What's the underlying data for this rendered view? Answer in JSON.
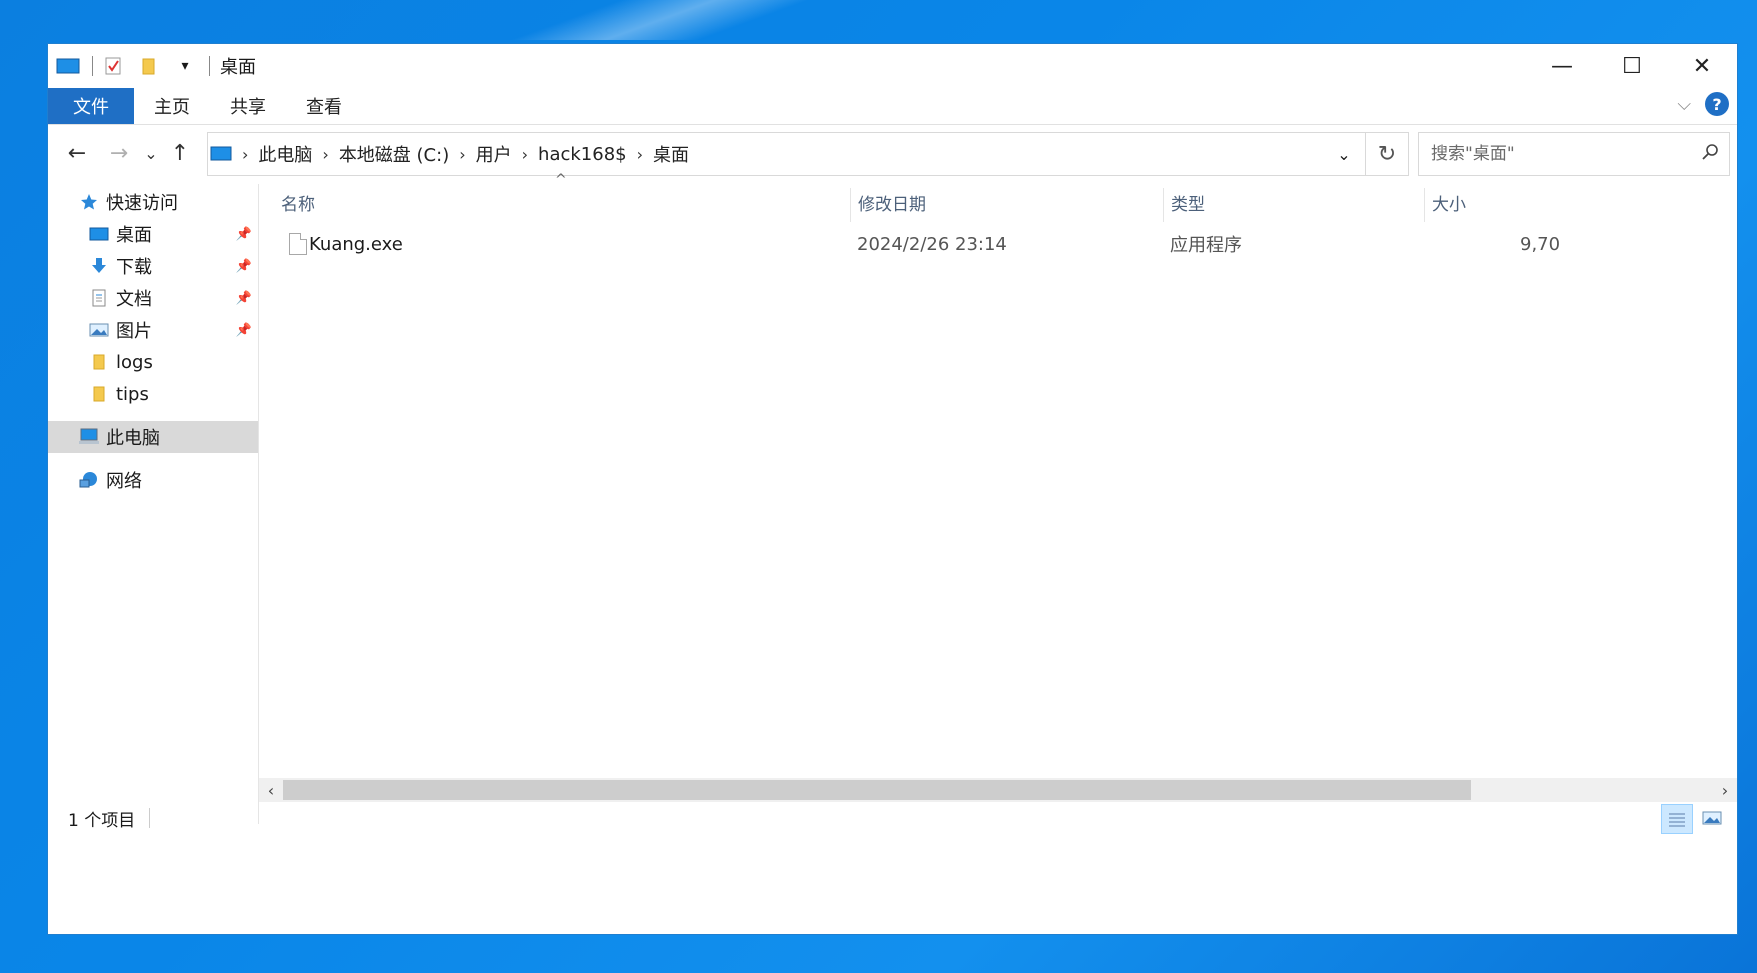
{
  "window": {
    "title": "桌面",
    "controls": {
      "minimize": "—",
      "maximize": "☐",
      "close": "✕"
    }
  },
  "ribbon": {
    "tabs": [
      "文件",
      "主页",
      "共享",
      "查看"
    ]
  },
  "nav": {
    "back": "←",
    "forward": "→",
    "recent": "⌄",
    "up": "↑",
    "breadcrumb": [
      "此电脑",
      "本地磁盘 (C:)",
      "用户",
      "hack168$",
      "桌面"
    ],
    "search_placeholder": "搜索\"桌面\""
  },
  "sidebar": {
    "quick_access": "快速访问",
    "pinned": [
      {
        "label": "桌面",
        "icon": "desktop-icon"
      },
      {
        "label": "下载",
        "icon": "download-icon"
      },
      {
        "label": "文档",
        "icon": "document-icon"
      },
      {
        "label": "图片",
        "icon": "pictures-icon"
      }
    ],
    "folders": [
      "logs",
      "tips"
    ],
    "this_pc": "此电脑",
    "network": "网络"
  },
  "file_list": {
    "columns": {
      "name": "名称",
      "modified": "修改日期",
      "type": "类型",
      "size": "大小"
    },
    "rows": [
      {
        "name": "Kuang.exe",
        "modified": "2024/2/26 23:14",
        "type": "应用程序",
        "size": "9,70"
      }
    ]
  },
  "status": {
    "item_count": "1 个项目"
  },
  "colors": {
    "accent": "#1f6fc5",
    "selection": "#d9d9d9",
    "header_text": "#4c607a"
  }
}
